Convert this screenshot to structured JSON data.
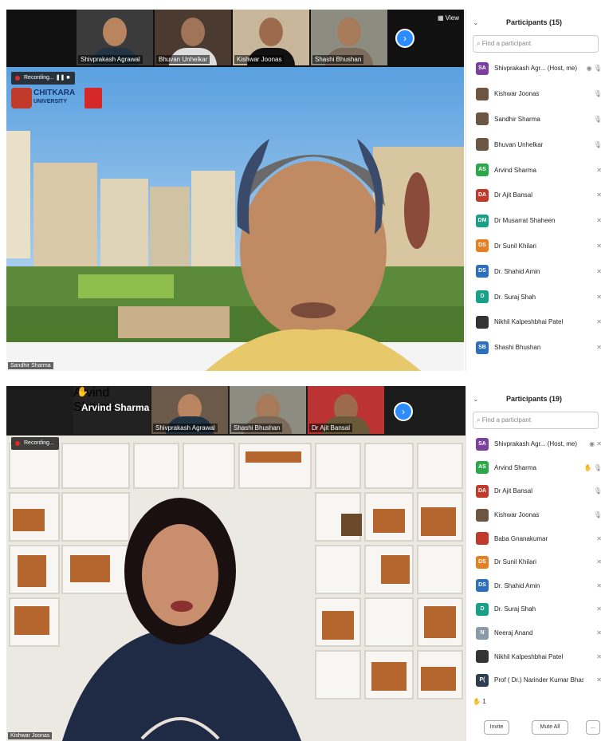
{
  "top": {
    "view_label": "View",
    "thumbs": [
      "Shivprakash Agrawal",
      "Bhuvan Unhelkar",
      "Kishwar Joonas",
      "Shashi Bhushan"
    ],
    "recording": "Recording...",
    "logo_text": "CHITKARA",
    "logo_sub": "UNIVERSITY",
    "speaker": "Sandhir Sharma",
    "panel_title": "Participants (15)",
    "search_placeholder": "Find a participant",
    "participants": [
      {
        "initials": "SA",
        "color": "#7b3fa0",
        "name": "Shivprakash Agr... (Host, me)",
        "icons": "◉ 🎙"
      },
      {
        "initials": "",
        "color": "#6b5544",
        "name": "Kishwar Joonas",
        "icons": "🎙"
      },
      {
        "initials": "",
        "color": "#6b5544",
        "name": "Sandhir Sharma",
        "icons": "🎙"
      },
      {
        "initials": "",
        "color": "#6b5544",
        "name": "Bhuvan Unhelkar",
        "icons": "🎙"
      },
      {
        "initials": "AS",
        "color": "#2aa84a",
        "name": "Arvind Sharma",
        "icons": "✕"
      },
      {
        "initials": "DA",
        "color": "#c0392b",
        "name": "Dr Ajit Bansal",
        "icons": "✕"
      },
      {
        "initials": "DM",
        "color": "#16a085",
        "name": "Dr Musarrat Shaheen",
        "icons": "✕"
      },
      {
        "initials": "DS",
        "color": "#e67e22",
        "name": "Dr Sunil Khilari",
        "icons": "✕"
      },
      {
        "initials": "DS",
        "color": "#2c6fbb",
        "name": "Dr. Shahid Amin",
        "icons": "✕"
      },
      {
        "initials": "D",
        "color": "#16a085",
        "name": "Dr. Suraj Shah",
        "icons": "✕"
      },
      {
        "initials": "",
        "color": "#333333",
        "name": "Nikhil Kalpeshbhai Patel",
        "icons": "✕"
      },
      {
        "initials": "SB",
        "color": "#2c6fbb",
        "name": "Shashi Bhushan",
        "icons": "✕"
      }
    ]
  },
  "bottom": {
    "active_speaker_label": "Arvind Sharma",
    "thumbs": [
      "Arvind Sharma",
      "Shivprakash Agrawal",
      "Shashi Bhushan",
      "Dr Ajit Bansal"
    ],
    "recording": "Recording...",
    "speaker": "Kishwar Joonas",
    "panel_title": "Participants (19)",
    "search_placeholder": "Find a participant",
    "participants": [
      {
        "initials": "SA",
        "color": "#7b3fa0",
        "name": "Shivprakash Agr... (Host, me)",
        "icons": "◉ ✕"
      },
      {
        "initials": "AS",
        "color": "#2aa84a",
        "name": "Arvind Sharma",
        "icons": "✋ 🎙"
      },
      {
        "initials": "DA",
        "color": "#c0392b",
        "name": "Dr Ajit Bansal",
        "icons": "🎙"
      },
      {
        "initials": "",
        "color": "#6b5544",
        "name": "Kishwar Joonas",
        "icons": "🎙"
      },
      {
        "initials": "",
        "color": "#c0392b",
        "name": "Baba Gnanakumar",
        "icons": "✕"
      },
      {
        "initials": "DS",
        "color": "#e67e22",
        "name": "Dr Sunil Khilari",
        "icons": "✕"
      },
      {
        "initials": "DS",
        "color": "#2c6fbb",
        "name": "Dr. Shahid Amin",
        "icons": "✕"
      },
      {
        "initials": "D",
        "color": "#16a085",
        "name": "Dr. Suraj Shah",
        "icons": "✕"
      },
      {
        "initials": "N",
        "color": "#8a9aa8",
        "name": "Neeraj Anand",
        "icons": "✕"
      },
      {
        "initials": "",
        "color": "#333333",
        "name": "Nikhil Kalpeshbhai Patel",
        "icons": "✕"
      },
      {
        "initials": "P(",
        "color": "#2c3e50",
        "name": "Prof ( Dr.) Narinder Kumar Bhas...",
        "icons": "✕"
      }
    ],
    "hand_count": "1",
    "invite_label": "Invite",
    "mute_all_label": "Mute All",
    "more_label": "..."
  }
}
